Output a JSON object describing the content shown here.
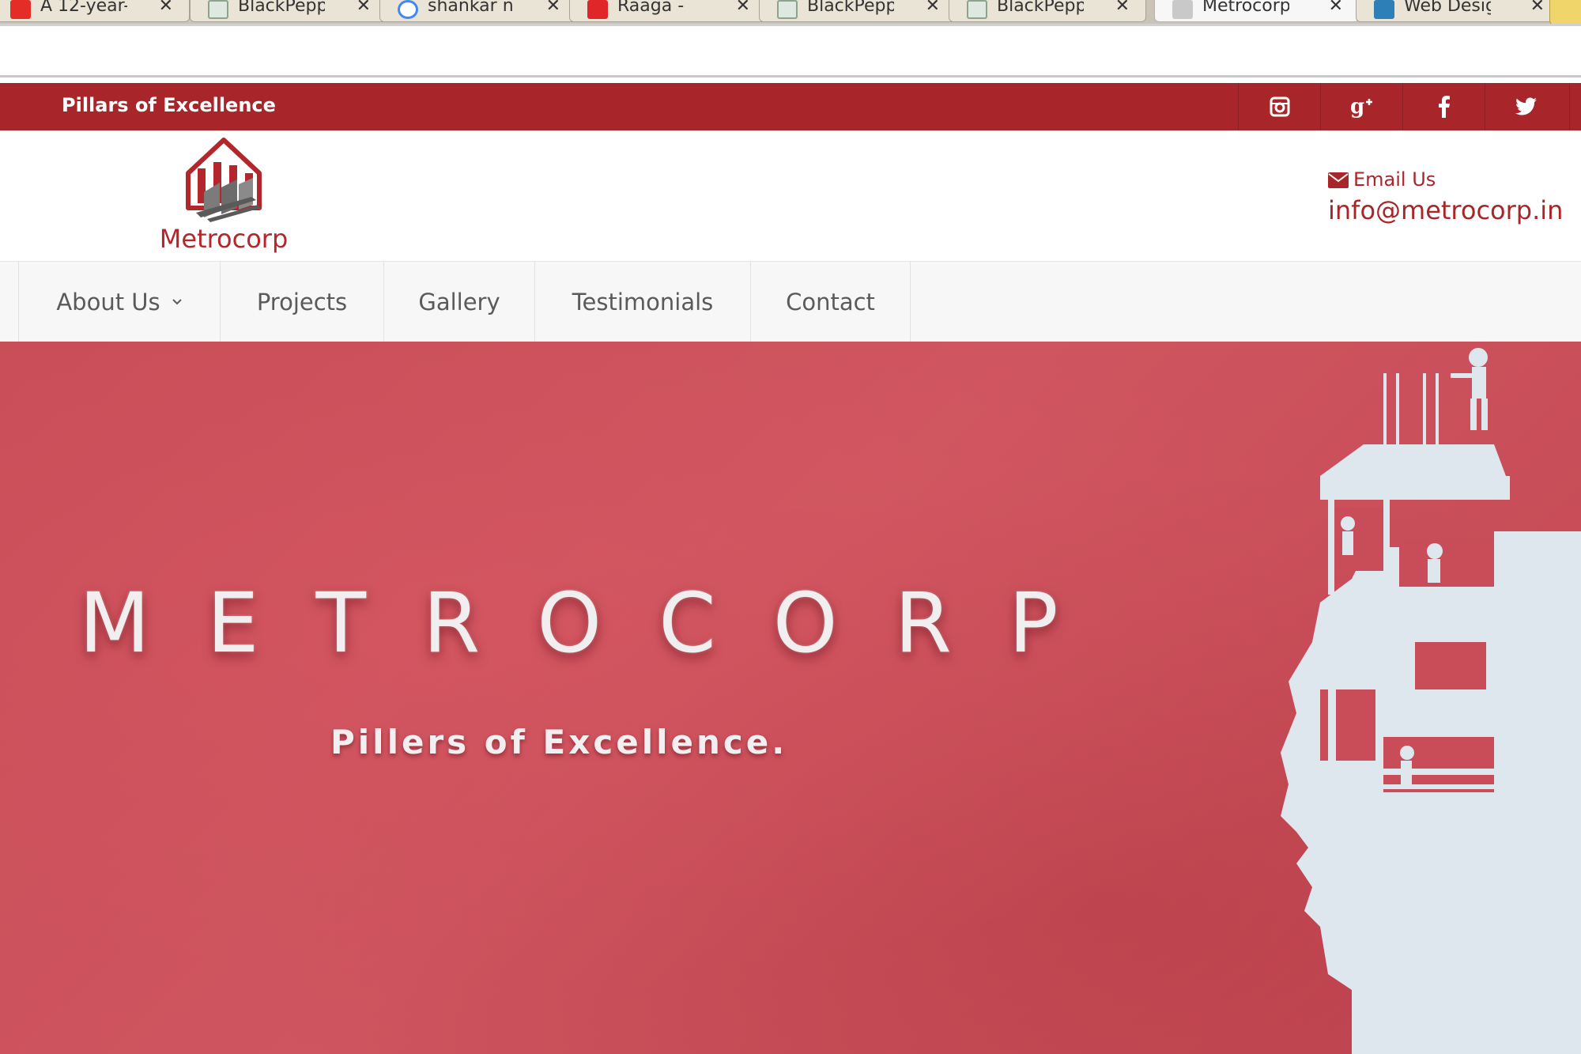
{
  "browser": {
    "tabs": [
      {
        "title": "A 12-year-",
        "icon": "youtube-icon",
        "color": "#e52d27"
      },
      {
        "title": "BlackPepp",
        "icon": "site-icon",
        "color": "#8aa58a"
      },
      {
        "title": "shankar na",
        "icon": "google-icon",
        "color": "#4285f4"
      },
      {
        "title": "Raaga -",
        "icon": "raaga-icon",
        "color": "#e1262a"
      },
      {
        "title": "BlackPepp",
        "icon": "site-icon",
        "color": "#8aa58a"
      },
      {
        "title": "BlackPepp",
        "icon": "site-icon",
        "color": "#8aa58a"
      },
      {
        "title": "Metrocorp",
        "icon": "metrocorp-icon",
        "color": "#777777"
      },
      {
        "title": "Web Desig",
        "icon": "site-icon",
        "color": "#2d7fb8"
      }
    ],
    "close_glyph": "✕"
  },
  "topbar": {
    "tagline": "Pillars of Excellence",
    "social": [
      "instagram-icon",
      "google-plus-icon",
      "facebook-icon",
      "twitter-icon"
    ],
    "color": "#a8262a"
  },
  "header": {
    "logo_text": "Metrocorp",
    "email_label": "Email Us",
    "email": "info@metrocorp.in"
  },
  "nav": {
    "items": [
      "About Us",
      "Projects",
      "Gallery",
      "Testimonials",
      "Contact"
    ]
  },
  "hero": {
    "title": "METROCORP",
    "subtitle": "Pillers of Excellence.",
    "bg_color": "#c84d58"
  }
}
